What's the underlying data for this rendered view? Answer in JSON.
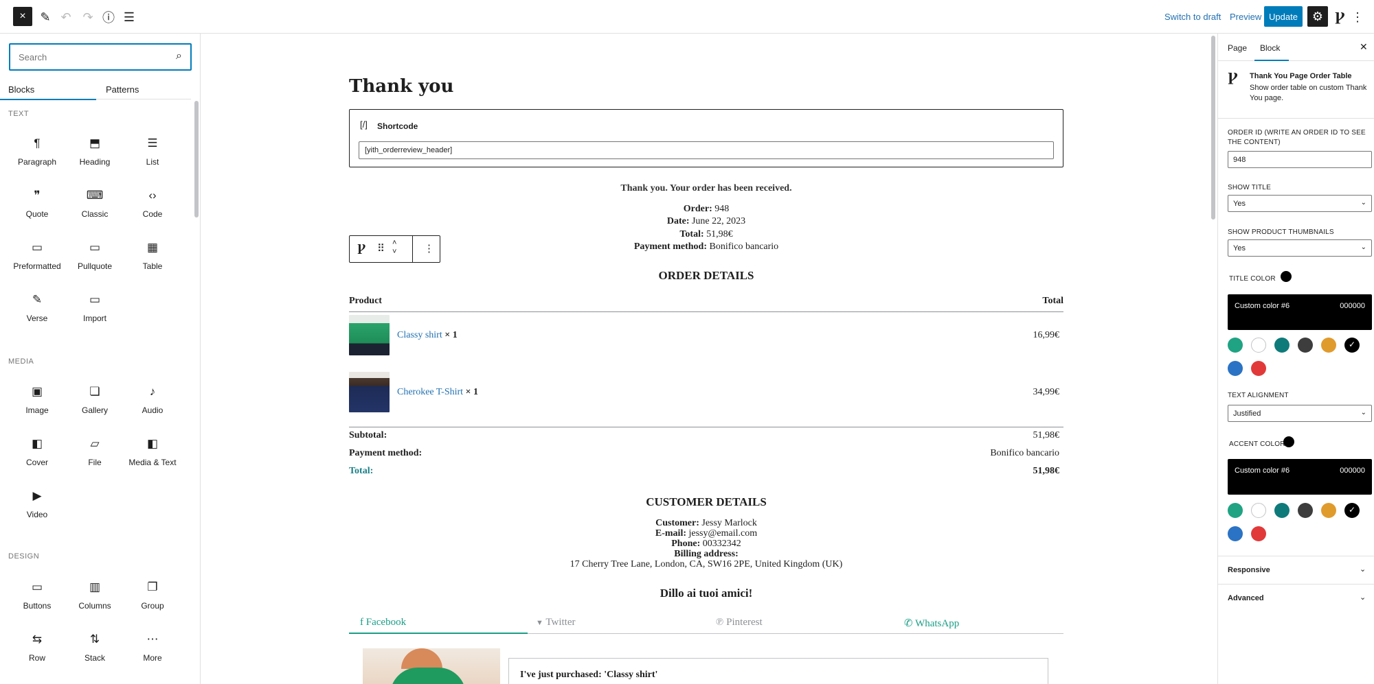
{
  "topbar": {
    "close_icon": "×",
    "switch_to_draft": "Switch to draft",
    "preview": "Preview",
    "update": "Update"
  },
  "inserter": {
    "search_placeholder": "Search",
    "tabs": [
      "Blocks",
      "Patterns"
    ],
    "categories": {
      "text": "TEXT",
      "media": "MEDIA",
      "design": "DESIGN"
    },
    "text_blocks": [
      {
        "label": "Paragraph",
        "icon": "¶"
      },
      {
        "label": "Heading",
        "icon": "⬒"
      },
      {
        "label": "List",
        "icon": "☰"
      },
      {
        "label": "Quote",
        "icon": "❞"
      },
      {
        "label": "Classic",
        "icon": "⌨"
      },
      {
        "label": "Code",
        "icon": "‹›"
      },
      {
        "label": "Preformatted",
        "icon": "▭"
      },
      {
        "label": "Pullquote",
        "icon": "▭"
      },
      {
        "label": "Table",
        "icon": "▦"
      },
      {
        "label": "Verse",
        "icon": "✎"
      },
      {
        "label": "Import",
        "icon": "▭"
      }
    ],
    "media_blocks": [
      {
        "label": "Image",
        "icon": "▣"
      },
      {
        "label": "Gallery",
        "icon": "❏"
      },
      {
        "label": "Audio",
        "icon": "♪"
      },
      {
        "label": "Cover",
        "icon": "◧"
      },
      {
        "label": "File",
        "icon": "▱"
      },
      {
        "label": "Media & Text",
        "icon": "◧"
      },
      {
        "label": "Video",
        "icon": "▶"
      }
    ],
    "design_blocks": [
      {
        "label": "Buttons",
        "icon": "▭"
      },
      {
        "label": "Columns",
        "icon": "▥"
      },
      {
        "label": "Group",
        "icon": "❐"
      },
      {
        "label": "Row",
        "icon": "⇆"
      },
      {
        "label": "Stack",
        "icon": "⇅"
      },
      {
        "label": "More",
        "icon": "⋯"
      }
    ]
  },
  "canvas": {
    "page_title": "Thank you",
    "shortcode_icon": "[/]",
    "shortcode_label": "Shortcode",
    "shortcode_value": "[yith_orderreview_header]",
    "received": "Thank you. Your order has been received.",
    "order_label": "Order:",
    "order_value": "948",
    "date_label": "Date:",
    "date_value": "June 22, 2023",
    "total_label": "Total:",
    "total_value": "51,98€",
    "payment_label": "Payment method:",
    "payment_value": "Bonifico bancario",
    "order_details": "ORDER DETAILS",
    "col_product": "Product",
    "col_total": "Total",
    "items": [
      {
        "name": "Classy shirt",
        "qty": "× 1",
        "total": "16,99€"
      },
      {
        "name": "Cherokee T-Shirt",
        "qty": "× 1",
        "total": "34,99€"
      }
    ],
    "subtotal_label": "Subtotal:",
    "subtotal_value": "51,98€",
    "pm_label": "Payment method:",
    "pm_value": "Bonifico bancario",
    "grand_total_label": "Total:",
    "grand_total_value": "51,98€",
    "customer_details": "CUSTOMER DETAILS",
    "customer_label": "Customer:",
    "customer_value": "Jessy Marlock",
    "email_label": "E-mail:",
    "email_value": "jessy@email.com",
    "phone_label": "Phone:",
    "phone_value": "00332342",
    "billing_label": "Billing address:",
    "billing_value": "17 Cherry Tree Lane, London, CA, SW16 2PE, United Kingdom (UK)",
    "share_title": "Dillo ai tuoi amici!",
    "share_tabs": [
      {
        "label": "Facebook",
        "icon": "f"
      },
      {
        "label": "Twitter",
        "icon": "🐦"
      },
      {
        "label": "Pinterest",
        "icon": "℗"
      },
      {
        "label": "WhatsApp",
        "icon": "✆"
      }
    ],
    "promo_text": "I've just purchased: 'Classy shirt'"
  },
  "sidebar": {
    "tabs": [
      "Page",
      "Block"
    ],
    "block_title": "Thank You Page Order Table",
    "block_desc": "Show order table on custom Thank You page.",
    "order_id_label": "ORDER ID (WRITE AN ORDER ID TO SEE THE CONTENT)",
    "order_id_value": "948",
    "show_title_label": "SHOW TITLE",
    "show_title_value": "Yes",
    "show_thumbs_label": "SHOW PRODUCT THUMBNAILS",
    "show_thumbs_value": "Yes",
    "title_color_label": "TITLE COLOR",
    "title_custom_name": "Custom color #6",
    "title_custom_hex": "000000",
    "text_align_label": "TEXT ALIGNMENT",
    "text_align_value": "Justified",
    "accent_color_label": "ACCENT COLOR",
    "accent_custom_name": "Custom color #6",
    "accent_custom_hex": "000000",
    "swatches": [
      "#1fa383",
      "#ffffff",
      "#0f7a7a",
      "#3d3d3d",
      "#e09b2d",
      "#000000",
      "#2b73c4",
      "#e1393a"
    ],
    "responsive": "Responsive",
    "advanced": "Advanced"
  }
}
